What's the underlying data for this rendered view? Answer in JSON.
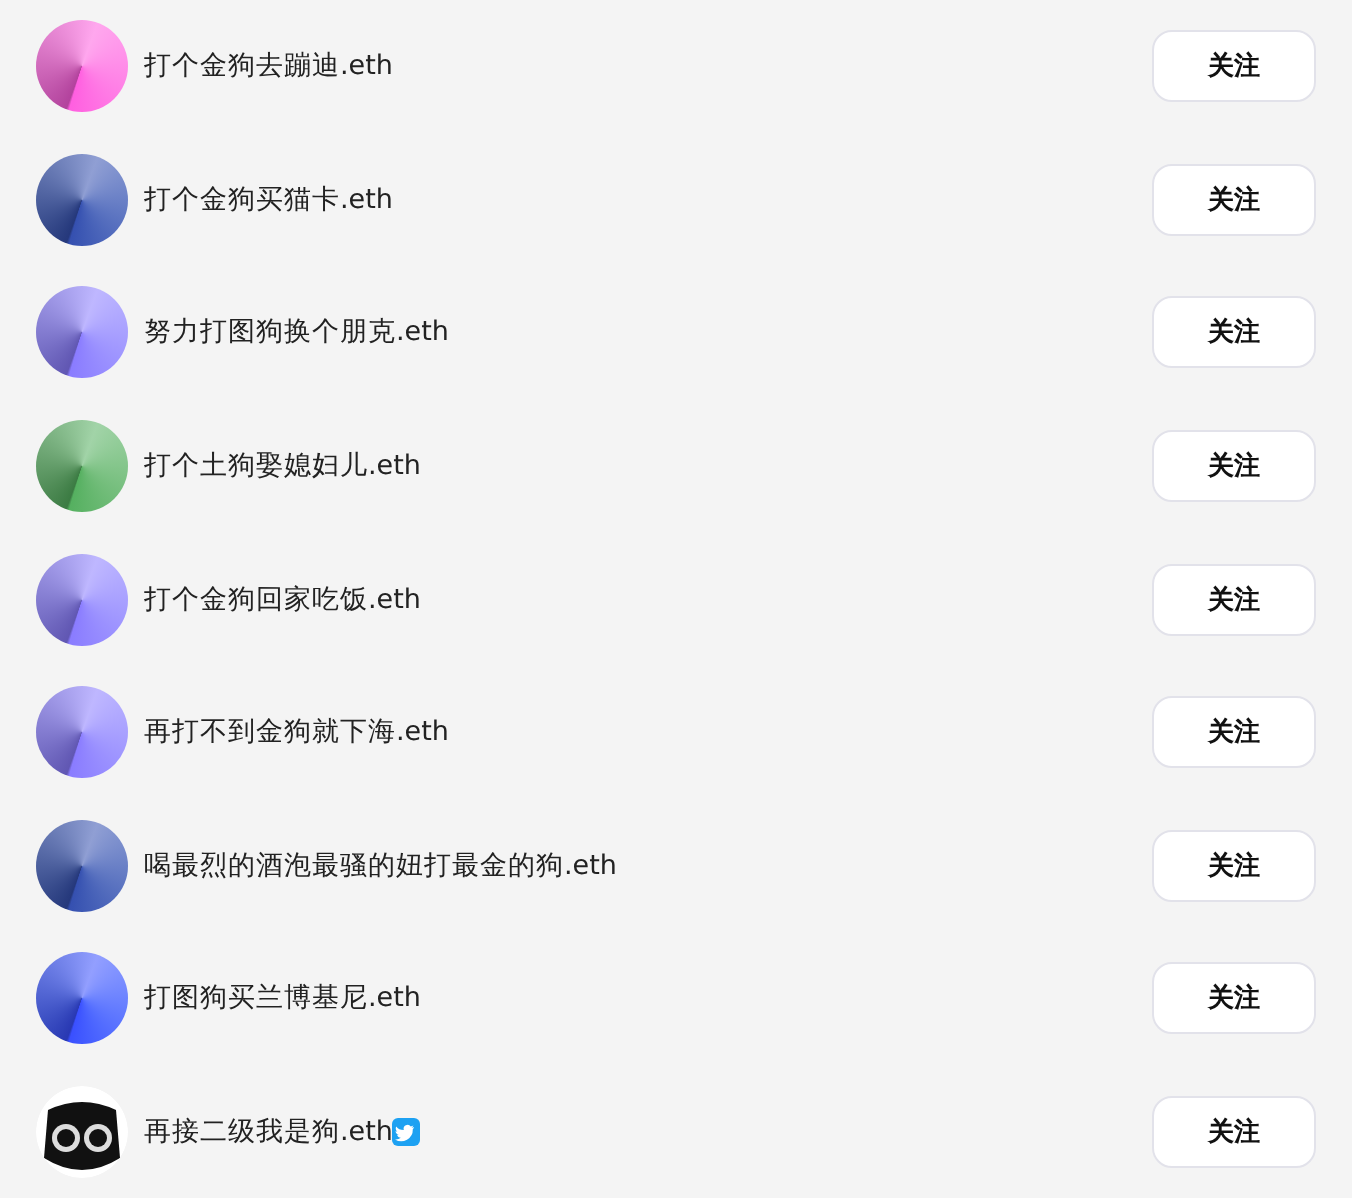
{
  "users": [
    {
      "name": "打个金狗去蹦迪.eth",
      "avatar": {
        "kind": "gradient",
        "color": "#ff5fe0"
      },
      "verified": false,
      "follow_label": "关注"
    },
    {
      "name": "打个金狗买猫卡.eth",
      "avatar": {
        "kind": "gradient",
        "color": "#3550b0"
      },
      "verified": false,
      "follow_label": "关注"
    },
    {
      "name": "努力打图狗换个朋克.eth",
      "avatar": {
        "kind": "gradient",
        "color": "#8a7cff"
      },
      "verified": false,
      "follow_label": "关注"
    },
    {
      "name": "打个土狗娶媳妇儿.eth",
      "avatar": {
        "kind": "gradient",
        "color": "#55b060"
      },
      "verified": false,
      "follow_label": "关注"
    },
    {
      "name": "打个金狗回家吃饭.eth",
      "avatar": {
        "kind": "gradient",
        "color": "#8a7cff"
      },
      "verified": false,
      "follow_label": "关注"
    },
    {
      "name": "再打不到金狗就下海.eth",
      "avatar": {
        "kind": "gradient",
        "color": "#8a7cff"
      },
      "verified": false,
      "follow_label": "关注"
    },
    {
      "name": "喝最烈的酒泡最骚的妞打最金的狗.eth",
      "avatar": {
        "kind": "gradient",
        "color": "#3550b0"
      },
      "verified": false,
      "follow_label": "关注"
    },
    {
      "name": "打图狗买兰博基尼.eth",
      "avatar": {
        "kind": "gradient",
        "color": "#3a50ff"
      },
      "verified": false,
      "follow_label": "关注"
    },
    {
      "name": "再接二级我是狗.eth",
      "avatar": {
        "kind": "mascot"
      },
      "verified": true,
      "follow_label": "关注"
    }
  ]
}
